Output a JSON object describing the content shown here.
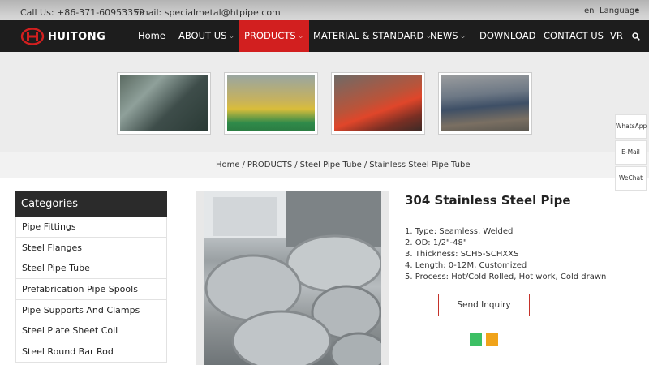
{
  "topbar": {
    "call": "Call Us: +86-371-60953359",
    "email": "Email: specialmetal@htpipe.com",
    "lang_code": "en",
    "language": "Language"
  },
  "brand": {
    "name": "HUITONG",
    "accent": "#d21f1f"
  },
  "nav": {
    "items": [
      {
        "label": "Home",
        "caret": false
      },
      {
        "label": "ABOUT US",
        "caret": true
      },
      {
        "label": "PRODUCTS",
        "caret": true,
        "active": true
      },
      {
        "label": "MATERIAL & STANDARD",
        "caret": true
      },
      {
        "label": "NEWS",
        "caret": true
      },
      {
        "label": "DOWNLOAD",
        "caret": false
      },
      {
        "label": "CONTACT US",
        "caret": false
      },
      {
        "label": "VR",
        "caret": false
      }
    ],
    "search_icon": "search-icon"
  },
  "breadcrumb": [
    "Home",
    "PRODUCTS",
    "Steel Pipe Tube",
    "Stainless Steel Pipe Tube"
  ],
  "categories": {
    "title": "Categories",
    "items": [
      "Pipe Fittings",
      "Steel Flanges",
      "Steel Pipe Tube",
      "Prefabrication Pipe Spools",
      "Pipe Supports And Clamps",
      "Steel Plate Sheet Coil",
      "Steel Round Bar Rod"
    ]
  },
  "product": {
    "title": "304 Stainless Steel Pipe",
    "specs": [
      "1. Type: Seamless, Welded",
      "2. OD: 1/2\"-48\"",
      "3. Thickness: SCH5-SCHXXS",
      "4. Length: 0-12M, Customized",
      "5. Process: Hot/Cold Rolled, Hot work, Cold drawn"
    ],
    "inquiry_label": "Send Inquiry"
  },
  "side": {
    "whatsapp": "WhatsApp",
    "email": "E-Mail",
    "wechat": "WeChat"
  }
}
